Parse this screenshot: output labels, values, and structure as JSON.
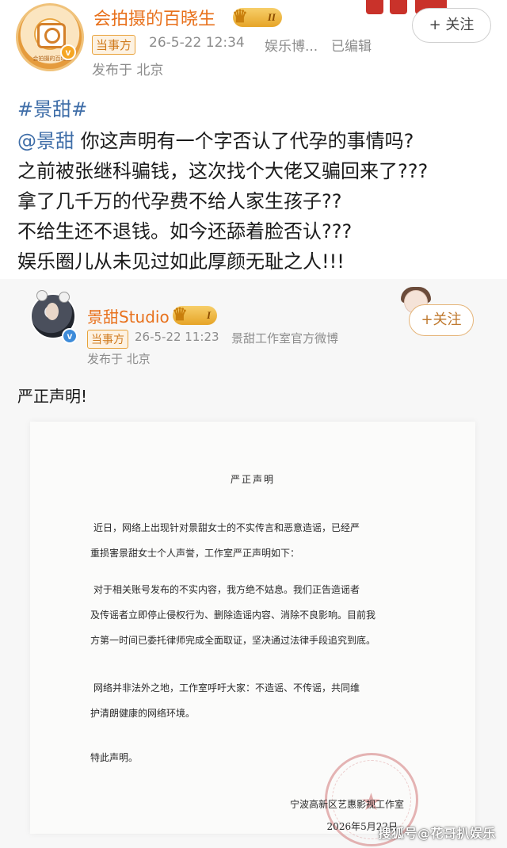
{
  "post": {
    "author": "会拍摄的百晓生",
    "level": "II",
    "tag": "当事方",
    "time": "26-5-22 12:34",
    "source": "娱乐博...",
    "edited": "已编辑",
    "location": "发布于 北京",
    "follow_label": "+ 关注",
    "avatar_caption": "会拍摄的百晓生",
    "hashtag": "#景甜#",
    "mention": "@景甜",
    "lines": [
      " 你这声明有一个字否认了代孕的事情吗?",
      "之前被张继科骗钱，这次找个大佬又骗回来了???",
      "拿了几千万的代孕费不给人家生孩子??",
      "不给生还不退钱。如今还舔着脸否认???",
      "娱乐圈儿从未见过如此厚颜无耻之人!!!"
    ]
  },
  "repost": {
    "author": "景甜Studio",
    "level": "I",
    "tag": "当事方",
    "time": "26-5-22 11:23",
    "source": "景甜工作室官方微博",
    "location": "发布于 北京",
    "follow_label": "+关注",
    "text": "严正声明!"
  },
  "document": {
    "title": "严正声明",
    "para1_line1": "近日，网络上出现针对景甜女士的不实传言和恶意造谣，已经严",
    "para1_line2": "重损害景甜女士个人声誉，工作室严正声明如下：",
    "para2_line1": "对于相关账号发布的不实内容，我方绝不姑息。我们正告造谣者",
    "para2_line2": "及传谣者立即停止侵权行为、删除造谣内容、消除不良影响。目前我",
    "para2_line3": "方第一时间已委托律师完成全面取证，坚决通过法律手段追究到底。",
    "para3_line1": "网络并非法外之地，工作室呼吁大家：不造谣、不传谣，共同维",
    "para3_line2": "护清朗健康的网络环境。",
    "closing": "特此声明。",
    "signature": "宁波高新区艺惠影视工作室",
    "date": "2026年5月22日"
  },
  "watermark": "搜狐号@花哥扒娱乐"
}
